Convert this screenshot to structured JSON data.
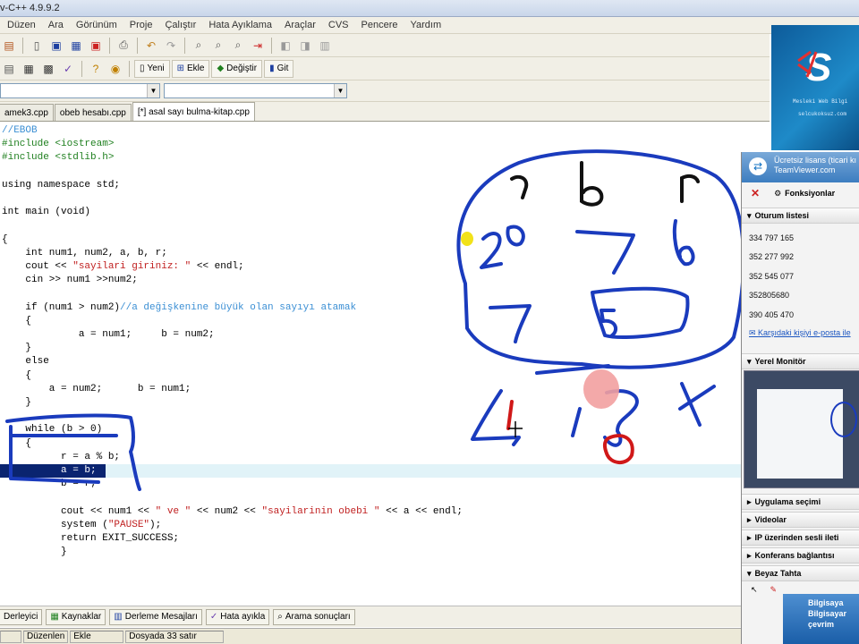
{
  "window": {
    "title": "v-C++ 4.9.9.2"
  },
  "menu": [
    "Düzen",
    "Ara",
    "Görünüm",
    "Proje",
    "Çalıştır",
    "Hata Ayıklama",
    "Araçlar",
    "CVS",
    "Pencere",
    "Yardım"
  ],
  "toolbar2": {
    "new_label": "Yeni",
    "add_label": "Ekle",
    "change_label": "Değiştir",
    "go_label": "Git"
  },
  "tabs": [
    "amek3.cpp",
    "obeb hesabı.cpp",
    "[*] asal sayı bulma-kitap.cpp"
  ],
  "code": [
    {
      "text": "//EBOB",
      "cls": "cmt"
    },
    {
      "text": "#include <iostream>",
      "cls": "dir"
    },
    {
      "text": "#include <stdlib.h>",
      "cls": "dir"
    },
    {
      "text": "",
      "cls": ""
    },
    {
      "text": "using namespace std;",
      "cls": ""
    },
    {
      "text": "",
      "cls": ""
    },
    {
      "text": "int main (void)",
      "cls": ""
    },
    {
      "text": "",
      "cls": ""
    },
    {
      "text": "{",
      "cls": ""
    },
    {
      "text": "    int num1, num2, a, b, r;",
      "cls": ""
    },
    {
      "text": "    cout << \"sayilari giriniz: \" << endl;",
      "cls": "mixstr"
    },
    {
      "text": "    cin >> num1 >>num2;",
      "cls": ""
    },
    {
      "text": "",
      "cls": ""
    },
    {
      "text": "    if (num1 > num2)//a değişkenine büyük olan sayıyı atamak",
      "cls": "mixcmt"
    },
    {
      "text": "    {",
      "cls": ""
    },
    {
      "text": "             a = num1;     b = num2;",
      "cls": ""
    },
    {
      "text": "    }",
      "cls": ""
    },
    {
      "text": "    else",
      "cls": ""
    },
    {
      "text": "    {",
      "cls": ""
    },
    {
      "text": "        a = num2;      b = num1;",
      "cls": ""
    },
    {
      "text": "    }",
      "cls": ""
    },
    {
      "text": "",
      "cls": ""
    },
    {
      "text": "    while (b > 0)",
      "cls": ""
    },
    {
      "text": "    {",
      "cls": ""
    },
    {
      "text": "          r = a % b;",
      "cls": ""
    },
    {
      "text": "          a = b;",
      "cls": "sel"
    },
    {
      "text": "          b = r;",
      "cls": ""
    },
    {
      "text": "",
      "cls": ""
    },
    {
      "text": "          cout << num1 << \" ve \" << num2 << \"sayilarinin obebi \" << a << endl;",
      "cls": "mixstr"
    },
    {
      "text": "          system (\"PAUSE\");",
      "cls": "mixstr"
    },
    {
      "text": "          return EXIT_SUCCESS;",
      "cls": ""
    },
    {
      "text": "          }",
      "cls": ""
    }
  ],
  "bottom_tabs": [
    "Derleyici",
    "Kaynaklar",
    "Derleme Mesajları",
    "Hata ayıkla",
    "Arama sonuçları"
  ],
  "status": [
    "",
    "Düzenlen",
    "Ekle",
    "Dosyada 33 satır"
  ],
  "teamviewer": {
    "header_line1": "Ücretsiz lisans (ticari kı",
    "header_line2": "TeamViewer.com",
    "functions_label": "Fonksiyonlar",
    "session_list_label": "Oturum listesi",
    "ids": [
      "334 797 165",
      "352 277 992",
      "352 545 077",
      "352805680",
      "390 405 470"
    ],
    "email_link": "Karşıdaki kişiyi e-posta ile",
    "local_monitor_label": "Yerel Monitör",
    "sections": [
      "Uygulama seçimi",
      "Videolar",
      "IP üzerinden sesli ileti",
      "Konferans bağlantısı",
      "Beyaz Tahta"
    ],
    "footer_line1": "Bilgisaya",
    "footer_line2": "Bilgisayar",
    "footer_line3": "çevrim"
  },
  "logo": {
    "tagline": "Mesleki Web Bilgi",
    "site": "selcukoksuz.com"
  },
  "accent_color": "#1a3bbd",
  "highlight_color": "#0a2470"
}
